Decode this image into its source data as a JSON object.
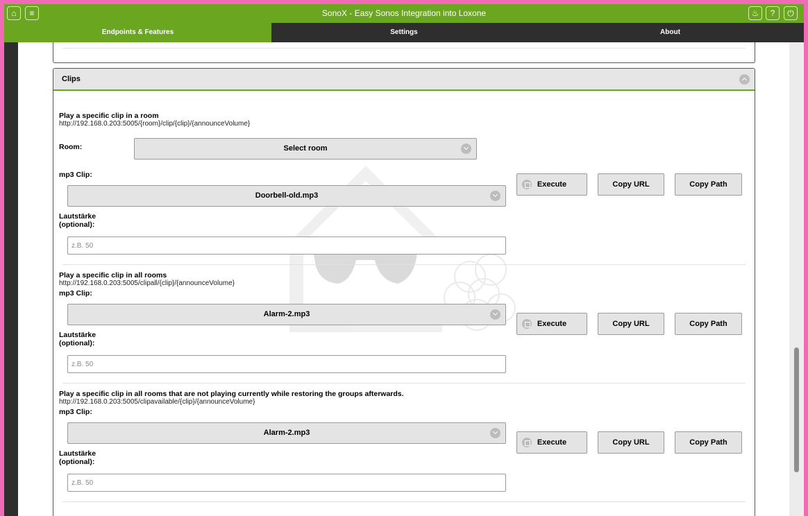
{
  "topbar": {
    "title": "SonoX - Easy Sonos Integration into Loxone",
    "icons": [
      "home-icon",
      "menu-icon",
      "bell-icon",
      "help-icon",
      "power-icon"
    ]
  },
  "tabs": [
    {
      "label": "Endpoints & Features",
      "active": true
    },
    {
      "label": "Settings",
      "active": false
    },
    {
      "label": "About",
      "active": false
    }
  ],
  "colors": {
    "accent": "#6aa620",
    "dark": "#2e2e2e",
    "frame": "#f06ab8"
  },
  "clips": {
    "header": "Clips",
    "sections": [
      {
        "title": "Play a specific clip in a room",
        "url": "http://192.168.0.203:5005/{room}/clip/{clip}/{announceVolume}",
        "room_label": "Room:",
        "room_value": "Select room",
        "clip_label": "mp3 Clip:",
        "clip_value": "Doorbell-old.mp3",
        "volume_label": "Lautstärke\n(optional):",
        "volume_placeholder": "z.B. 50",
        "execute": "Execute",
        "copy_url": "Copy URL",
        "copy_path": "Copy Path"
      },
      {
        "title": "Play a specific clip in all rooms",
        "url": "http://192.168.0.203:5005/clipall/{clip}/{announceVolume}",
        "clip_label": "mp3 Clip:",
        "clip_value": "Alarm-2.mp3",
        "volume_label": "Lautstärke\n(optional):",
        "volume_placeholder": "z.B. 50",
        "execute": "Execute",
        "copy_url": "Copy URL",
        "copy_path": "Copy Path"
      },
      {
        "title": "Play a specific clip in all rooms that are not playing currently while restoring the groups afterwards.",
        "url": "http://192.168.0.203:5005/clipavailable/{clip}/{announceVolume}",
        "clip_label": "mp3 Clip:",
        "clip_value": "Alarm-2.mp3",
        "volume_label": "Lautstärke\n(optional):",
        "volume_placeholder": "z.B. 50",
        "execute": "Execute",
        "copy_url": "Copy URL",
        "copy_path": "Copy Path"
      }
    ]
  }
}
